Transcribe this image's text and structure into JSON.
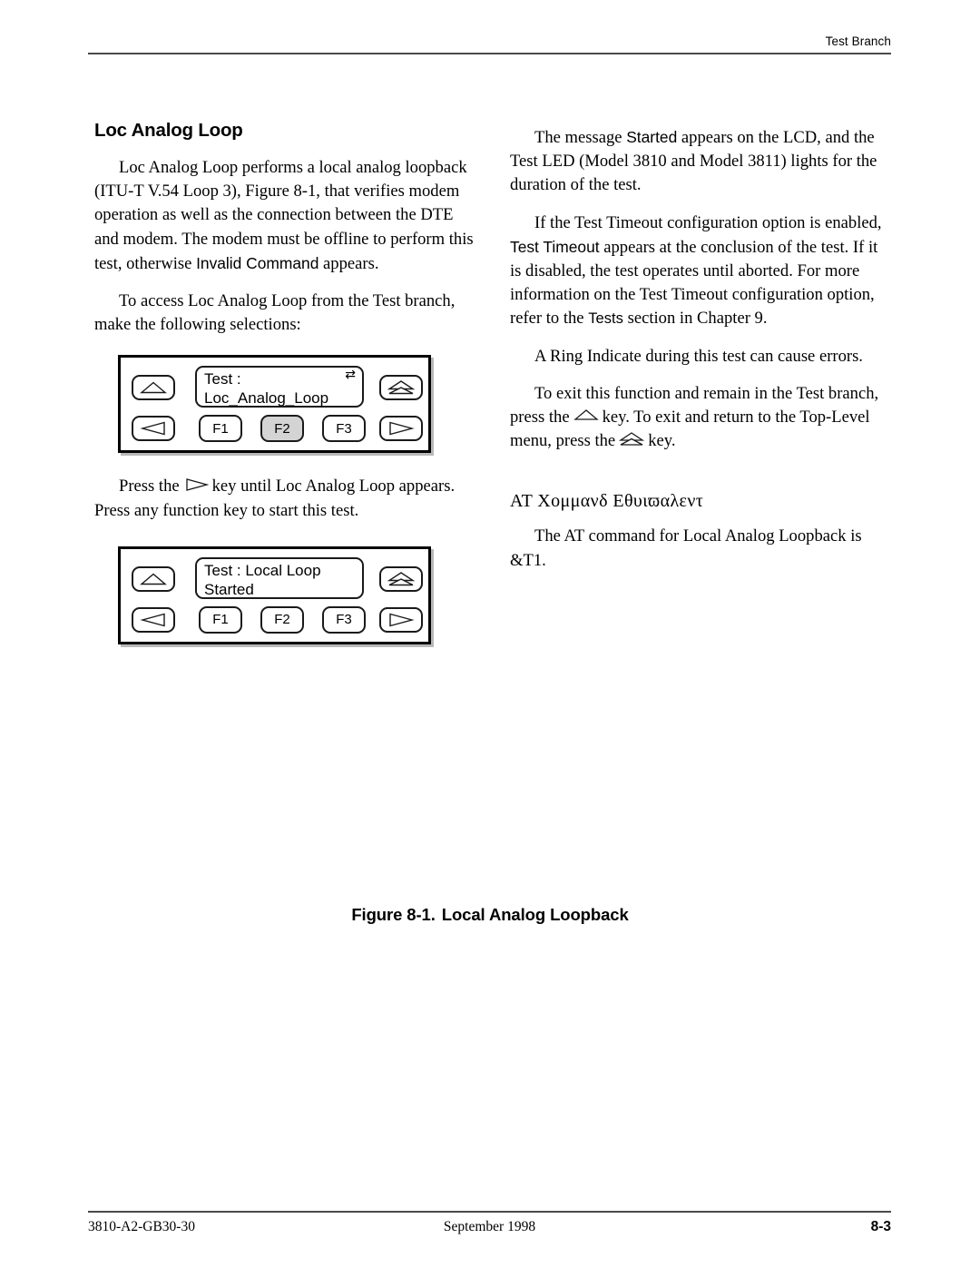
{
  "header": {
    "running_head": "Test Branch",
    "rule_color": "#4a4a4a"
  },
  "left_column": {
    "section_title": "Loc Analog Loop",
    "paragraph_1_a": "Loc Analog Loop performs a local analog loopback (ITU-T V.54 Loop 3), Figure 8-1, that verifies modem operation as well as the connection between the DTE and modem. The modem must be offline to perform this test, otherwise ",
    "paragraph_1_ui": "Invalid Command",
    "paragraph_1_b": " appears.",
    "paragraph_2": "To access Loc Analog Loop from the Test branch, make the following selections:",
    "paragraph_3_a": "Press the",
    "paragraph_3_glyph": "right-arrow-key",
    "paragraph_3_b": "key until Loc Analog Loop appears. Press any function key to start this test."
  },
  "right_column": {
    "paragraph_1_a": "The message ",
    "paragraph_1_ui": "Started",
    "paragraph_1_b": " appears on the LCD, and the Test LED (Model 3810 and Model 3811) lights for the duration of the test.",
    "paragraph_2_a": "If the Test Timeout configuration option is enabled, ",
    "paragraph_2_ui": "Test Timeout",
    "paragraph_2_b": " appears at the conclusion of the test. If it is disabled, the test operates until aborted. For more information on the Test Timeout configuration option, refer to the ",
    "paragraph_2_em": "Tests",
    "paragraph_2_c": " section in Chapter 9.",
    "paragraph_3": "A Ring Indicate during this test can cause errors.",
    "paragraph_4_a": "To exit this function and remain in the Test branch, press the",
    "paragraph_4_glyph_1": "up-arrow-key",
    "paragraph_4_b": "key. To exit and return to the Top-Level menu, press the",
    "paragraph_4_glyph_2": "top-level-key",
    "paragraph_4_c": "key.",
    "at_section_title": "ΑΤ Χομμανδ Εθυιϖαλεντ",
    "at_paragraph": "The AT command for Local Analog Loopback is &T1."
  },
  "panels": [
    {
      "id": "panel-loc-analog-loop",
      "lcd_line_1": "Test :",
      "lcd_line_2": "Loc_Analog_Loop",
      "xfer_indicator": "⇄",
      "show_xfer": true,
      "function_keys": [
        {
          "label": "F1",
          "active": false
        },
        {
          "label": "F2",
          "active": true
        },
        {
          "label": "F3",
          "active": false
        }
      ],
      "nav_keys": {
        "up": "up-arrow-key",
        "left": "left-arrow-key",
        "top_level": "top-level-key",
        "right": "right-arrow-key"
      }
    },
    {
      "id": "panel-local-loop-started",
      "lcd_line_1": "Test : Local Loop",
      "lcd_line_2": "Started",
      "xfer_indicator": "",
      "show_xfer": false,
      "function_keys": [
        {
          "label": "F1",
          "active": false
        },
        {
          "label": "F2",
          "active": false
        },
        {
          "label": "F3",
          "active": false
        }
      ],
      "nav_keys": {
        "up": "up-arrow-key",
        "left": "left-arrow-key",
        "top_level": "top-level-key",
        "right": "right-arrow-key"
      }
    }
  ],
  "figure": {
    "number": "Figure 8-1.",
    "title": "Local Analog Loopback"
  },
  "footer": {
    "left": "3810-A2-GB30-30",
    "center": "September 1998",
    "right": "8-3"
  },
  "colors": {
    "ink": "#000000",
    "rule": "#4a4a4a",
    "key_active_fill": "#d4d4d4",
    "panel_shadow": "#b8b8b8"
  }
}
